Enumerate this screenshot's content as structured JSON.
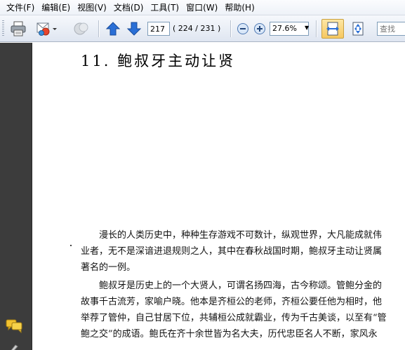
{
  "menu": [
    "文件(F)",
    "编辑(E)",
    "视图(V)",
    "文档(D)",
    "工具(T)",
    "窗口(W)",
    "帮助(H)"
  ],
  "toolbar": {
    "current_page": "217",
    "page_total": "( 224 / 231 )",
    "zoom": "27.6%",
    "search_placeholder": "查找",
    "icons": [
      "printer-icon",
      "email-icon",
      "disabled-icon",
      "prev-page-icon",
      "next-page-icon",
      "zoom-out-icon",
      "zoom-in-icon",
      "fit-width-icon",
      "fit-page-icon"
    ]
  },
  "document": {
    "chapter_title": "11. 鲍叔牙主动让贤",
    "paragraphs": [
      [
        "漫长的人类历史中，种种生存游戏不可数计，纵观世界，大凡能成就伟",
        "业者，无不是深谙进退规则之人，其中在春秋战国时期，鲍叔牙主动让贤属",
        "著名的一例。"
      ],
      [
        "鲍叔牙是历史上的一个大贤人，可谓名扬四海，古今称颂。管鲍分金的",
        "故事千古流芳，家喻户晓。他本是齐桓公的老师，齐桓公要任他为相时，他",
        "举荐了管仲，自己甘居下位，共辅桓公成就霸业，传为千古美谈，以至有“管",
        "鲍之交”的成语。鲍氏在齐十余世皆为名大夫，历代忠臣名人不断，家风永"
      ]
    ]
  },
  "colors": {
    "nav_pane": "#3c3c3c",
    "arrow_blue": "#2a6fd6",
    "comment_yellow": "#f2c230"
  }
}
